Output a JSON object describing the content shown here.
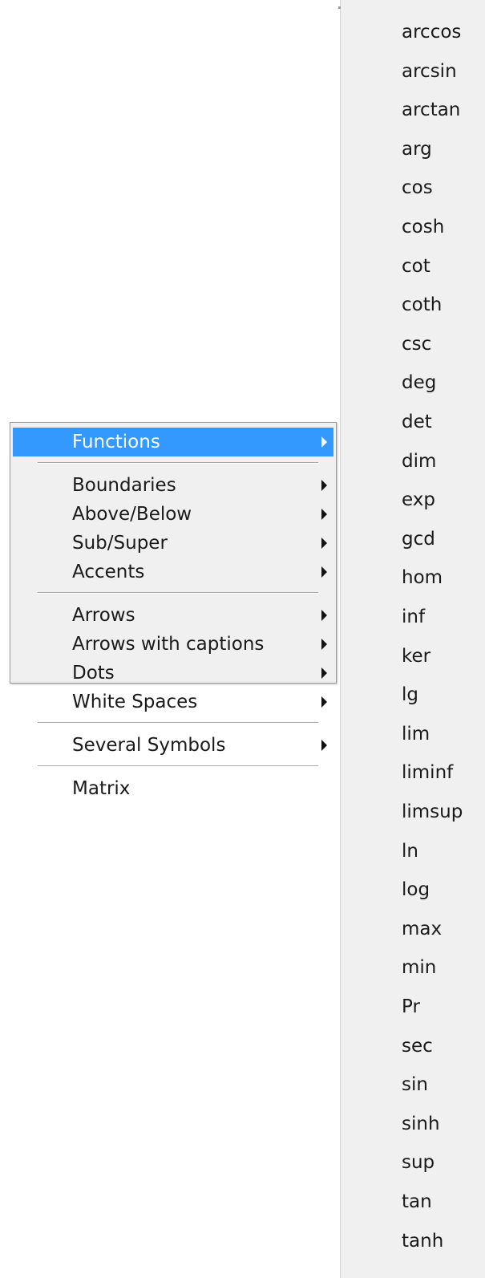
{
  "main_menu": {
    "groups": [
      [
        {
          "label": "Functions",
          "has_submenu": true,
          "highlighted": true
        }
      ],
      [
        {
          "label": "Boundaries",
          "has_submenu": true
        },
        {
          "label": "Above/Below",
          "has_submenu": true
        },
        {
          "label": "Sub/Super",
          "has_submenu": true
        },
        {
          "label": "Accents",
          "has_submenu": true
        }
      ],
      [
        {
          "label": "Arrows",
          "has_submenu": true
        },
        {
          "label": "Arrows with captions",
          "has_submenu": true
        },
        {
          "label": "Dots",
          "has_submenu": true
        },
        {
          "label": "White Spaces",
          "has_submenu": true
        }
      ],
      [
        {
          "label": "Several Symbols",
          "has_submenu": true
        }
      ],
      [
        {
          "label": "Matrix",
          "has_submenu": false
        }
      ]
    ]
  },
  "functions_submenu": {
    "items": [
      "arccos",
      "arcsin",
      "arctan",
      "arg",
      "cos",
      "cosh",
      "cot",
      "coth",
      "csc",
      "deg",
      "det",
      "dim",
      "exp",
      "gcd",
      "hom",
      "inf",
      "ker",
      "lg",
      "lim",
      "liminf",
      "limsup",
      "ln",
      "log",
      "max",
      "min",
      "Pr",
      "sec",
      "sin",
      "sinh",
      "sup",
      "tan",
      "tanh"
    ]
  },
  "colors": {
    "highlight": "#3399ff",
    "menu_background": "#f0f0f0",
    "text": "#1a1a1a"
  }
}
